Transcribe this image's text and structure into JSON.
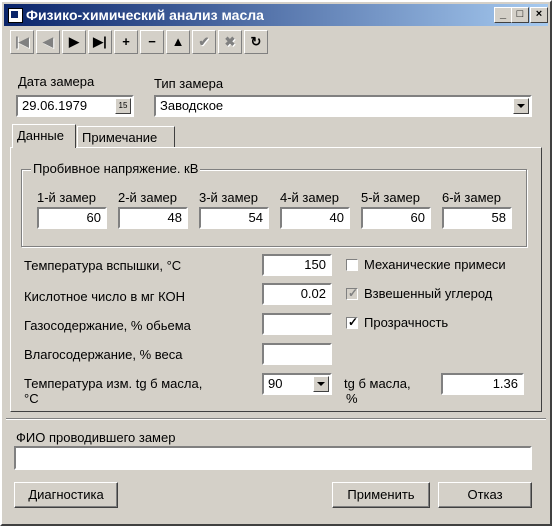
{
  "window": {
    "title": "Физико-химический анализ масла"
  },
  "title_buttons": {
    "minimize": "_",
    "maximize": "□",
    "close": "×"
  },
  "navigator": {
    "buttons": [
      {
        "name": "first",
        "glyph": "|◀",
        "enabled": false
      },
      {
        "name": "prior",
        "glyph": "◀",
        "enabled": false
      },
      {
        "name": "next",
        "glyph": "▶",
        "enabled": true
      },
      {
        "name": "last",
        "glyph": "▶|",
        "enabled": true
      },
      {
        "name": "insert",
        "glyph": "+",
        "enabled": true
      },
      {
        "name": "delete",
        "glyph": "−",
        "enabled": true
      },
      {
        "name": "edit",
        "glyph": "▲",
        "enabled": true
      },
      {
        "name": "post",
        "glyph": "✔",
        "enabled": false
      },
      {
        "name": "cancel",
        "glyph": "✖",
        "enabled": false
      },
      {
        "name": "refresh",
        "glyph": "↻",
        "enabled": true
      }
    ]
  },
  "header": {
    "date_label": "Дата замера",
    "date_value": "29.06.1979",
    "calendar_icon_text": "15",
    "type_label": "Тип замера",
    "type_value": "Заводское"
  },
  "tabs": [
    {
      "label": "Данные",
      "active": true
    },
    {
      "label": "Примечание",
      "active": false
    }
  ],
  "breakdown": {
    "title": "Пробивное напряжение. кВ",
    "measurements": [
      {
        "label": "1-й замер",
        "value": "60"
      },
      {
        "label": "2-й замер",
        "value": "48"
      },
      {
        "label": "3-й замер",
        "value": "54"
      },
      {
        "label": "4-й замер",
        "value": "40"
      },
      {
        "label": "5-й замер",
        "value": "60"
      },
      {
        "label": "6-й замер",
        "value": "58"
      }
    ]
  },
  "fields": {
    "flash_temp_label": "Температура вспышки, °С",
    "flash_temp_value": "150",
    "acid_label": "Кислотное число в мг КОН",
    "acid_value": "0.02",
    "gas_label": "Газосодержание, % обьема",
    "gas_value": "",
    "moisture_label": "Влагосодержание, % веса",
    "moisture_value": "",
    "tgtemp_label_1": "Температура изм. tg б масла,",
    "tgtemp_label_2": "°С",
    "tgtemp_value": "90",
    "tg_label_1": "tg б масла,",
    "tg_label_2": "%",
    "tg_value": "1.36"
  },
  "checkboxes": [
    {
      "label": "Механические примеси",
      "checked": false,
      "enabled": true
    },
    {
      "label": "Взвешенный углерод",
      "checked": true,
      "enabled": false
    },
    {
      "label": "Прозрачность",
      "checked": true,
      "enabled": true
    }
  ],
  "footer": {
    "operator_label": "ФИО проводившего замер",
    "operator_value": "",
    "diag_button": "Диагностика",
    "apply_button": "Применить",
    "cancel_button": "Отказ"
  }
}
